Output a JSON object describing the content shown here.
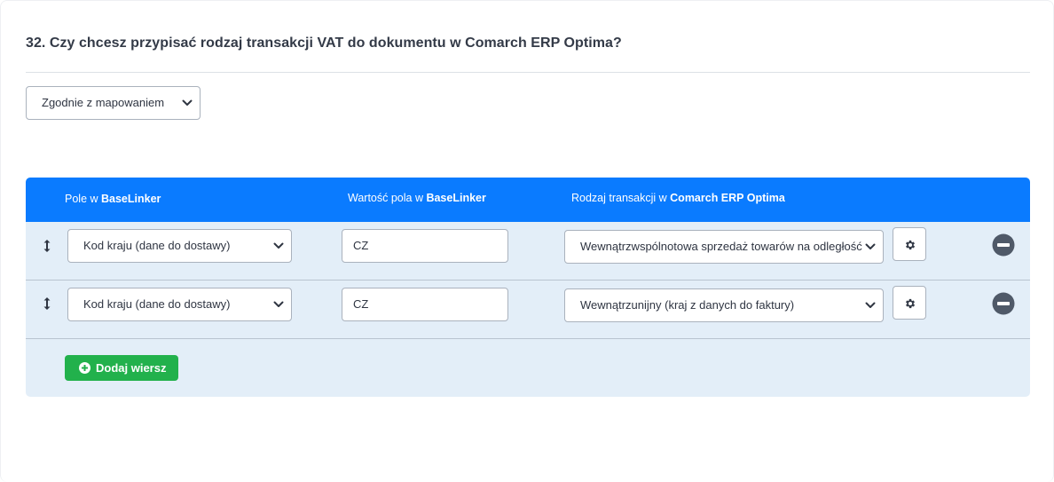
{
  "question": {
    "title": "32. Czy chcesz przypisać rodzaj transakcji VAT do dokumentu w Comarch ERP Optima?"
  },
  "mode_select": {
    "value": "Zgodnie z mapowaniem"
  },
  "table": {
    "header": {
      "col1_prefix": "Pole w ",
      "col1_bold": "BaseLinker",
      "col2_prefix": "Wartość pola w ",
      "col2_bold": "BaseLinker",
      "col3_prefix": "Rodzaj transakcji w ",
      "col3_bold": "Comarch ERP Optima"
    },
    "rows": [
      {
        "field": "Kod kraju (dane do dostawy)",
        "value": "CZ",
        "transaction": "Wewnątrzwspólnotowa sprzedaż towarów na odległość"
      },
      {
        "field": "Kod kraju (dane do dostawy)",
        "value": "CZ",
        "transaction": "Wewnątrzunijny (kraj z danych do faktury)"
      }
    ],
    "add_row_label": "Dodaj wiersz"
  },
  "colors": {
    "header_bg": "#0a7bff",
    "table_bg": "#e3eef8",
    "add_button": "#22b14c",
    "remove_icon": "#4f5968"
  },
  "icons": {
    "drag": "drag-vertical-arrows-icon",
    "settings": "gear-icon",
    "remove": "minus-circle-icon",
    "add": "plus-circle-icon",
    "dropdown": "chevron-down-icon"
  }
}
